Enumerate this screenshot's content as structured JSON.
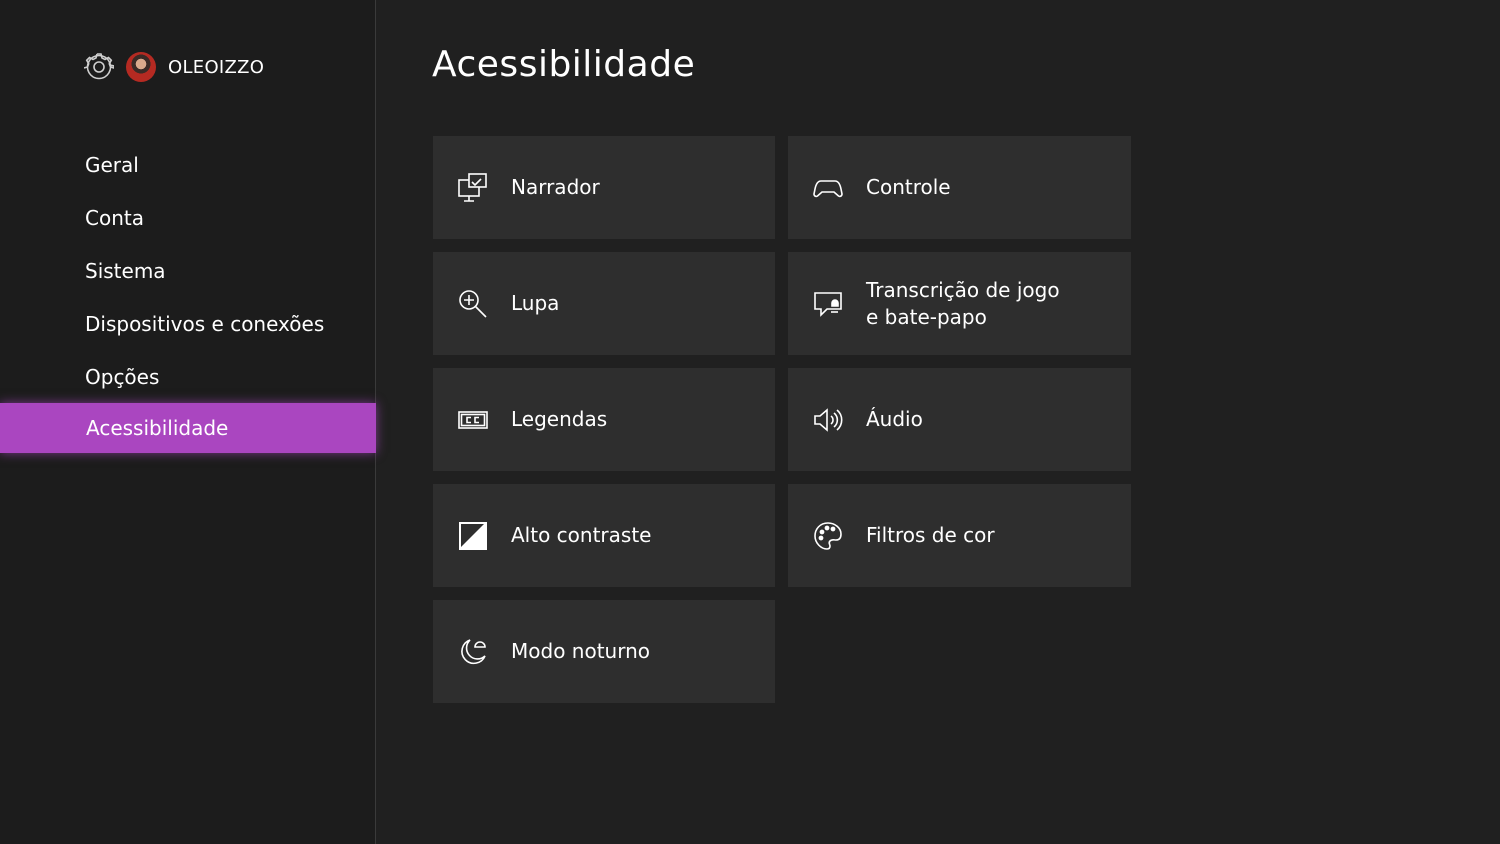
{
  "user": {
    "username": "OLEOIZZO"
  },
  "sidebar": {
    "items": [
      {
        "label": "Geral"
      },
      {
        "label": "Conta"
      },
      {
        "label": "Sistema"
      },
      {
        "label": "Dispositivos e conexões"
      },
      {
        "label": "Opções"
      },
      {
        "label": "Acessibilidade",
        "selected": true
      }
    ]
  },
  "main": {
    "title": "Acessibilidade",
    "tiles": [
      {
        "label": "Narrador",
        "icon": "narrator-icon"
      },
      {
        "label": "Controle",
        "icon": "controller-icon"
      },
      {
        "label": "Lupa",
        "icon": "magnifier-icon"
      },
      {
        "label": "Transcrição de jogo e bate-papo",
        "icon": "chat-transcription-icon"
      },
      {
        "label": "Legendas",
        "icon": "closed-captions-icon"
      },
      {
        "label": "Áudio",
        "icon": "speaker-icon"
      },
      {
        "label": "Alto contraste",
        "icon": "high-contrast-icon"
      },
      {
        "label": "Filtros de cor",
        "icon": "color-palette-icon"
      },
      {
        "label": "Modo noturno",
        "icon": "night-mode-icon"
      }
    ]
  },
  "colors": {
    "background": "#202020",
    "sidebar": "#1c1c1c",
    "tile": "#2e2e2e",
    "accent": "#aa46c0",
    "text": "#ffffff"
  }
}
